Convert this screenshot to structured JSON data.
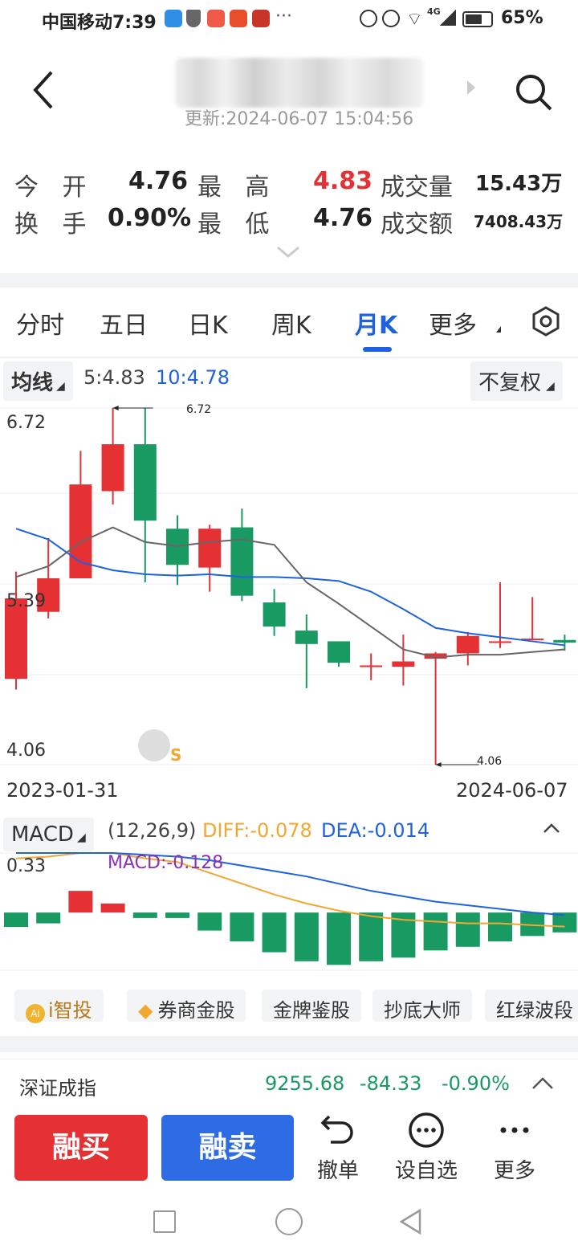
{
  "status": {
    "carrier_time": "中国移动7:39",
    "network": "4G",
    "battery": "65%"
  },
  "header": {
    "update_time": "更新:2024-06-07 15:04:56"
  },
  "stats": {
    "open_label": "今 开",
    "open": "4.76",
    "high_label": "最 高",
    "high": "4.83",
    "volume_label": "成交量",
    "volume": "15.43万",
    "turnover_label": "换 手",
    "turnover": "0.90%",
    "low_label": "最 低",
    "low": "4.76",
    "amount_label": "成交额",
    "amount": "7408.43万"
  },
  "tabs": [
    "分时",
    "五日",
    "日K",
    "周K",
    "月K",
    "更多"
  ],
  "active_tab": "月K",
  "ma": {
    "label": "均线",
    "ma5": "5:4.83",
    "ma10": "10:4.78",
    "adjust": "不复权"
  },
  "kchart": {
    "y_labels": {
      "top": "6.72",
      "mid": "5.39",
      "bottom": "4.06"
    },
    "max_annot": "6.72",
    "min_annot": "4.06",
    "date_start": "2023-01-31",
    "date_end": "2024-06-07",
    "s_marker": "S"
  },
  "macd": {
    "label": "MACD",
    "params": "(12,26,9)",
    "diff": "DIFF:-0.078",
    "dea": "DEA:-0.014",
    "macd": "MACD:-0.128",
    "y_top": "0.33"
  },
  "chips": [
    "i智投",
    "券商金股",
    "金牌鉴股",
    "抄底大师",
    "红绿波段"
  ],
  "index_bar": {
    "name": "深证成指",
    "value": "9255.68",
    "change": "-84.33",
    "pct": "-0.90%"
  },
  "actions": {
    "buy": "融买",
    "sell": "融卖",
    "cancel": "撤单",
    "watch": "设自选",
    "more": "更多"
  },
  "colors": {
    "up": "#e53034",
    "down": "#1a9a63",
    "accent": "#1f62e0",
    "diff": "#f0a830",
    "dea": "#1f62e0",
    "macd_label": "#8a2fb8"
  },
  "chart_data": {
    "type": "candlestick",
    "candles": [
      {
        "o": 4.7,
        "c": 5.3,
        "h": 5.5,
        "l": 4.62
      },
      {
        "o": 5.2,
        "c": 5.45,
        "h": 5.75,
        "l": 5.15
      },
      {
        "o": 5.45,
        "c": 6.15,
        "h": 6.4,
        "l": 5.45
      },
      {
        "o": 6.1,
        "c": 6.45,
        "h": 6.72,
        "l": 6.0
      },
      {
        "o": 6.45,
        "c": 5.88,
        "h": 6.72,
        "l": 5.42
      },
      {
        "o": 5.82,
        "c": 5.55,
        "h": 5.92,
        "l": 5.4
      },
      {
        "o": 5.53,
        "c": 5.82,
        "h": 5.85,
        "l": 5.35
      },
      {
        "o": 5.83,
        "c": 5.32,
        "h": 5.97,
        "l": 5.28
      },
      {
        "o": 5.27,
        "c": 5.09,
        "h": 5.37,
        "l": 5.02
      },
      {
        "o": 5.06,
        "c": 4.96,
        "h": 5.18,
        "l": 4.63
      },
      {
        "o": 4.98,
        "c": 4.82,
        "h": 4.98,
        "l": 4.79
      },
      {
        "o": 4.8,
        "c": 4.8,
        "h": 4.89,
        "l": 4.69
      },
      {
        "o": 4.79,
        "c": 4.83,
        "h": 5.03,
        "l": 4.65
      },
      {
        "o": 4.85,
        "c": 4.89,
        "h": 4.9,
        "l": 4.06
      },
      {
        "o": 4.89,
        "c": 5.02,
        "h": 5.05,
        "l": 4.8
      },
      {
        "o": 4.98,
        "c": 4.98,
        "h": 5.42,
        "l": 4.93
      },
      {
        "o": 5.0,
        "c": 5.0,
        "h": 5.31,
        "l": 4.99
      },
      {
        "o": 4.99,
        "c": 4.97,
        "h": 5.03,
        "l": 4.91
      }
    ],
    "ma5": [
      5.46,
      5.54,
      5.72,
      5.83,
      5.72,
      5.69,
      5.72,
      5.74,
      5.7,
      5.42,
      5.26,
      5.09,
      4.92,
      4.86,
      4.88,
      4.88,
      4.9,
      4.92
    ],
    "ma10": [
      5.82,
      5.74,
      5.57,
      5.51,
      5.48,
      5.47,
      5.48,
      5.46,
      5.46,
      5.45,
      5.43,
      5.35,
      5.22,
      5.08,
      5.04,
      5.01,
      4.98,
      4.95
    ],
    "macd_hist": [
      -0.08,
      -0.06,
      0.12,
      0.05,
      -0.03,
      -0.03,
      -0.1,
      -0.16,
      -0.22,
      -0.27,
      -0.29,
      -0.27,
      -0.25,
      -0.21,
      -0.19,
      -0.16,
      -0.13,
      -0.11
    ],
    "dif": [
      0.3,
      0.31,
      0.33,
      0.33,
      0.3,
      0.28,
      0.22,
      0.16,
      0.1,
      0.05,
      0.01,
      -0.02,
      -0.04,
      -0.05,
      -0.06,
      -0.06,
      -0.07,
      -0.078
    ],
    "dea": [
      0.33,
      0.33,
      0.33,
      0.33,
      0.32,
      0.31,
      0.29,
      0.26,
      0.23,
      0.2,
      0.16,
      0.12,
      0.09,
      0.06,
      0.04,
      0.02,
      0.0,
      -0.014
    ],
    "ylim": [
      4.06,
      6.72
    ],
    "macd_ylim": [
      -0.32,
      0.33
    ]
  }
}
